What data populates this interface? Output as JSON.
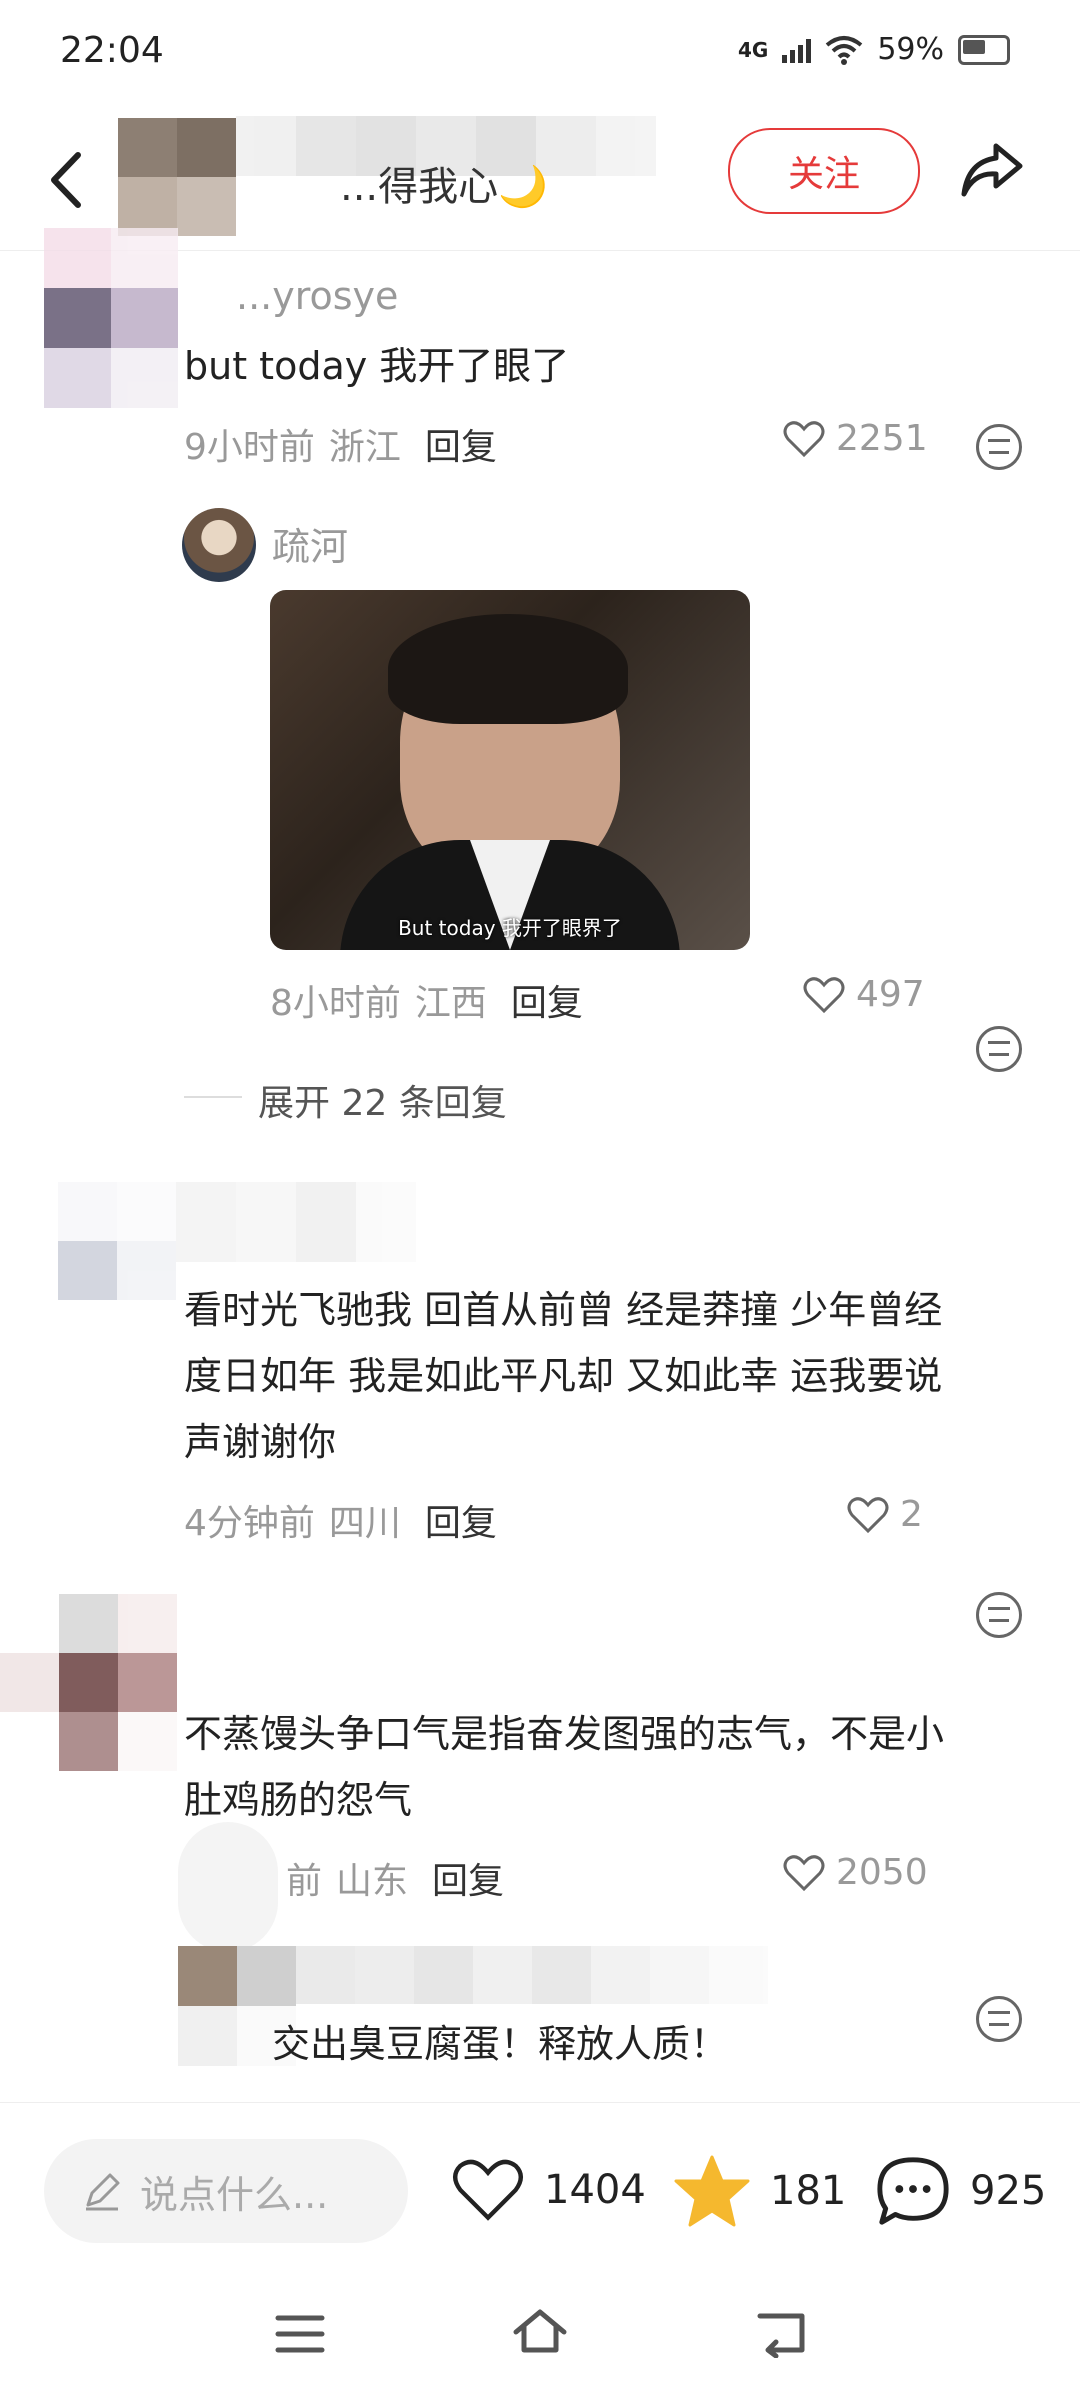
{
  "status_bar": {
    "time": "22:04",
    "network": "4G",
    "battery": "59%"
  },
  "header": {
    "title": "...得我心🌙",
    "follow_label": "关注"
  },
  "comments": [
    {
      "username": "...yrosye",
      "text": "but today 我开了眼了",
      "time": "9小时前",
      "location": "浙江",
      "reply_label": "回复",
      "likes": "2251",
      "replies": [
        {
          "username": "疏河",
          "image_caption": "But today 我开了眼界了",
          "time": "8小时前",
          "location": "江西",
          "reply_label": "回复",
          "likes": "497"
        }
      ],
      "expand_label": "展开 22 条回复"
    },
    {
      "username": "",
      "text_lines": [
        "看时光飞驰我  回首从前曾 经是莽撞 少年曾经",
        "度日如年 我是如此平凡却 又如此幸 运我要说",
        "声谢谢你"
      ],
      "time": "4分钟前",
      "location": "四川",
      "reply_label": "回复",
      "likes": "2"
    },
    {
      "username": "",
      "text_lines": [
        "不蒸馒头争口气是指奋发图强的志气，不是小",
        "肚鸡肠的怨气"
      ],
      "time": "前",
      "location": "山东",
      "reply_label": "回复",
      "likes": "2050",
      "replies": [
        {
          "username": "",
          "text": "交出臭豆腐蛋！释放人质！"
        }
      ]
    }
  ],
  "bottom_bar": {
    "input_placeholder": "说点什么...",
    "likes": "1404",
    "favorites": "181",
    "comments": "925"
  },
  "colors": {
    "accent": "#e53a3a",
    "star": "#f5b82e",
    "muted": "#999999"
  }
}
